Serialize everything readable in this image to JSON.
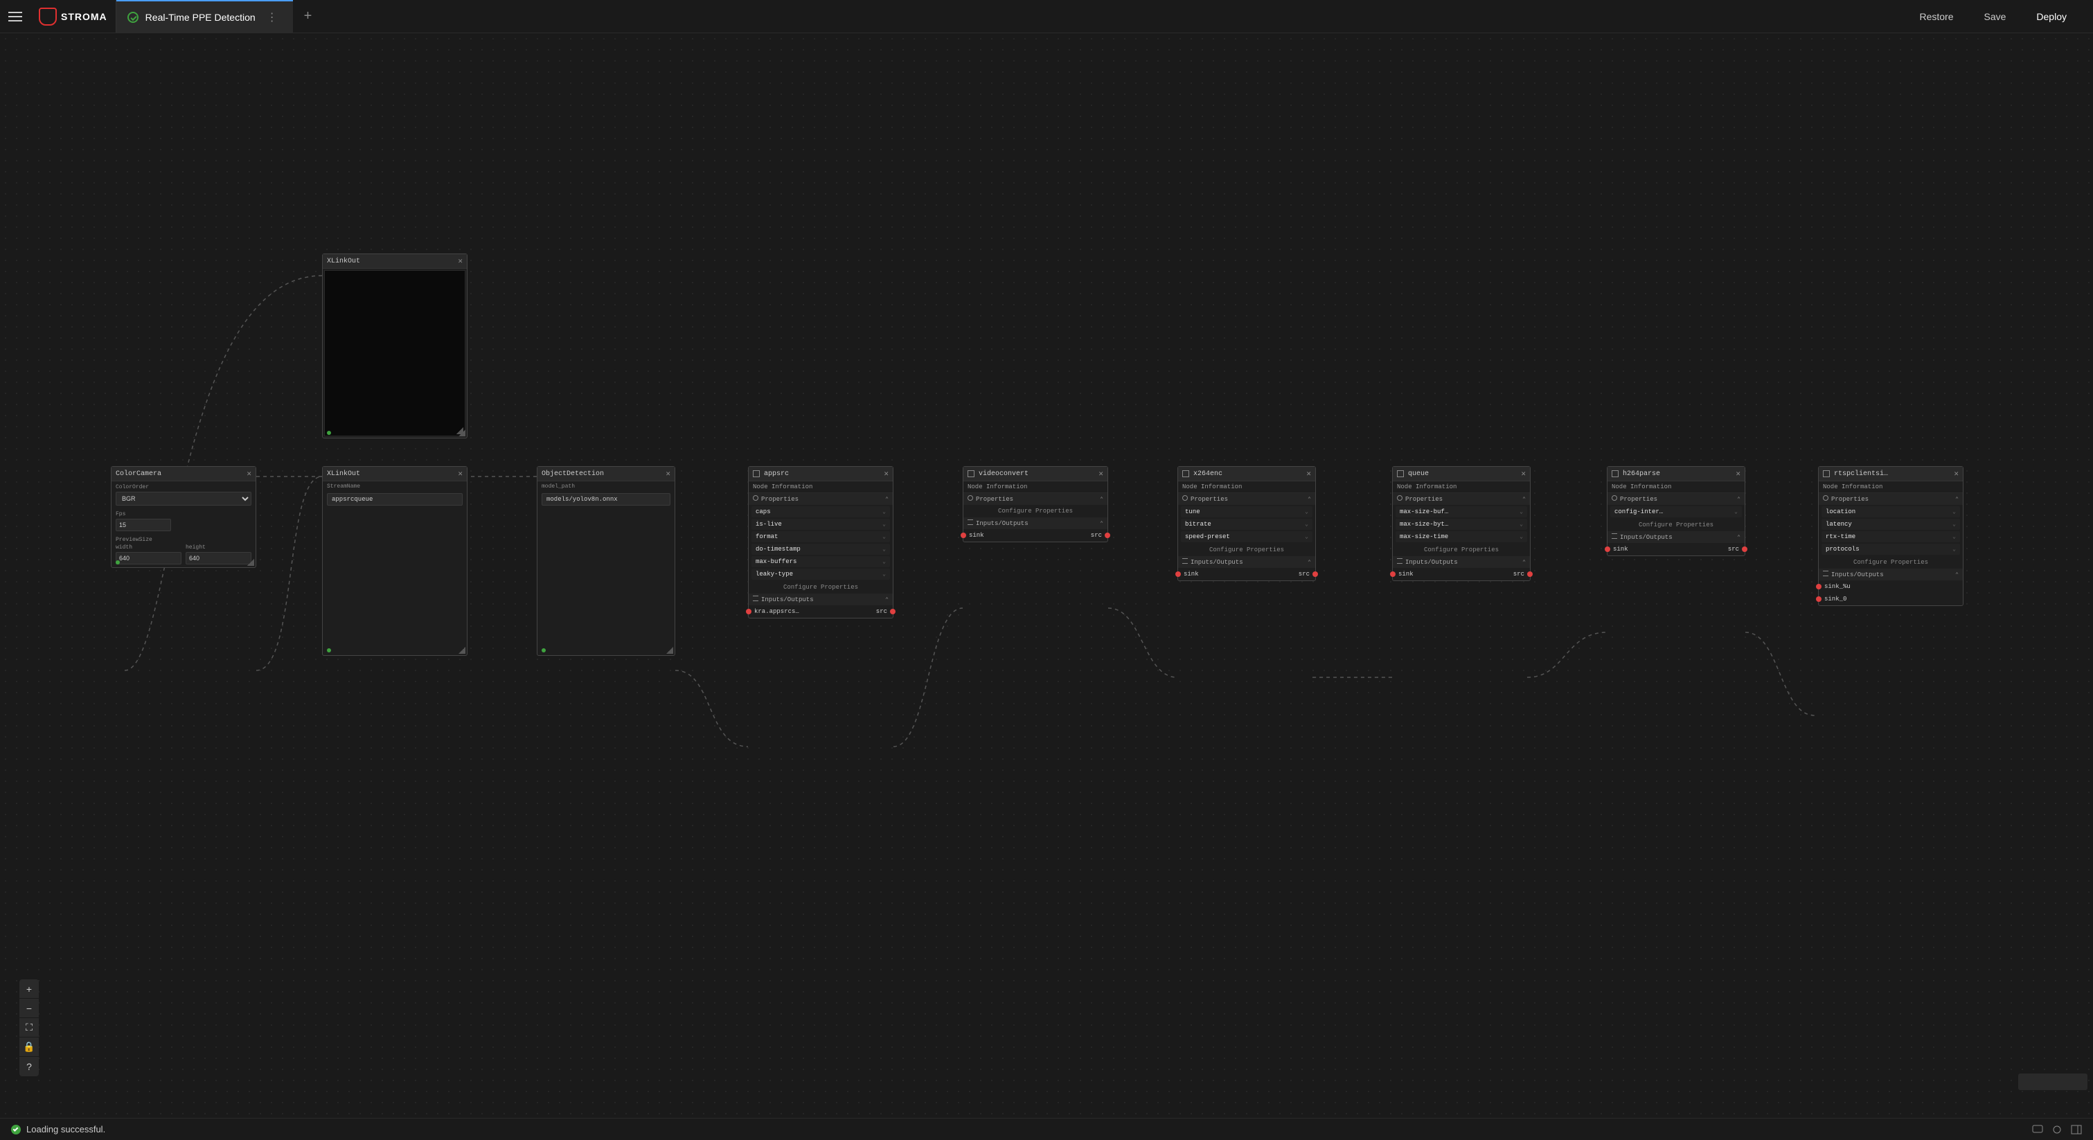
{
  "header": {
    "logo_text": "STROMA",
    "tab_title": "Real-Time PPE Detection",
    "restore": "Restore",
    "save": "Save",
    "deploy": "Deploy"
  },
  "footer": {
    "status": "Loading successful."
  },
  "nodes": {
    "color_camera": {
      "title": "ColorCamera",
      "color_order_label": "ColorOrder",
      "color_order_value": "BGR",
      "fps_label": "Fps",
      "fps_value": "15",
      "preview_label": "PreviewSize",
      "width_label": "width",
      "width_value": "640",
      "height_label": "height",
      "height_value": "640"
    },
    "xlinkout1": {
      "title": "XLinkOut"
    },
    "xlinkout2": {
      "title": "XLinkOut",
      "stream_label": "StreamName",
      "stream_value": "appsrcqueue"
    },
    "object_detection": {
      "title": "ObjectDetection",
      "model_label": "model_path",
      "model_value": "models/yolov8n.onnx"
    },
    "appsrc": {
      "title": "appsrc",
      "node_info": "Node Information",
      "properties": "Properties",
      "props": [
        "caps",
        "is-live",
        "format",
        "do-timestamp",
        "max-buffers",
        "leaky-type"
      ],
      "config": "Configure Properties",
      "io": "Inputs/Outputs",
      "sink": "kra.appsrcs…",
      "src": "src"
    },
    "videoconvert": {
      "title": "videoconvert",
      "node_info": "Node Information",
      "properties": "Properties",
      "config": "Configure Properties",
      "io": "Inputs/Outputs",
      "sink": "sink",
      "src": "src"
    },
    "x264enc": {
      "title": "x264enc",
      "node_info": "Node Information",
      "properties": "Properties",
      "props": [
        "tune",
        "bitrate",
        "speed-preset"
      ],
      "config": "Configure Properties",
      "io": "Inputs/Outputs",
      "sink": "sink",
      "src": "src"
    },
    "queue": {
      "title": "queue",
      "node_info": "Node Information",
      "properties": "Properties",
      "props": [
        "max-size-buf…",
        "max-size-byt…",
        "max-size-time"
      ],
      "config": "Configure Properties",
      "io": "Inputs/Outputs",
      "sink": "sink",
      "src": "src"
    },
    "h264parse": {
      "title": "h264parse",
      "node_info": "Node Information",
      "properties": "Properties",
      "props": [
        "config-inter…"
      ],
      "config": "Configure Properties",
      "io": "Inputs/Outputs",
      "sink": "sink",
      "src": "src"
    },
    "rtspclientsink": {
      "title": "rtspclientsi…",
      "node_info": "Node Information",
      "properties": "Properties",
      "props": [
        "location",
        "latency",
        "rtx-time",
        "protocols"
      ],
      "config": "Configure Properties",
      "io": "Inputs/Outputs",
      "sink1": "sink_%u",
      "sink2": "sink_0"
    }
  }
}
